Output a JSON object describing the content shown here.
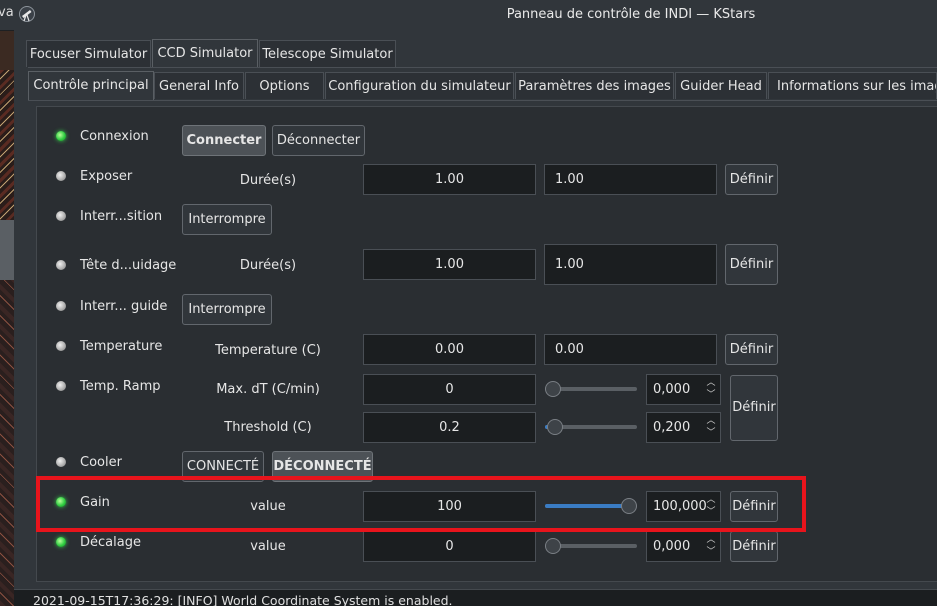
{
  "window": {
    "title": "Panneau de contrôle de INDI — KStars",
    "left_edge_text": "va"
  },
  "device_tabs": [
    {
      "label": "Focuser Simulator",
      "active": false
    },
    {
      "label": "CCD Simulator",
      "active": true
    },
    {
      "label": "Telescope Simulator",
      "active": false
    }
  ],
  "group_tabs": [
    {
      "label": "Contrôle principal",
      "active": true
    },
    {
      "label": "General Info",
      "active": false
    },
    {
      "label": "Options",
      "active": false
    },
    {
      "label": "Configuration du simulateur",
      "active": false
    },
    {
      "label": "Paramètres des images",
      "active": false
    },
    {
      "label": "Guider Head",
      "active": false
    },
    {
      "label": "Informations sur les images",
      "active": false
    }
  ],
  "properties": {
    "connexion": {
      "label": "Connexion",
      "state": "green",
      "btn_connect": "Connecter",
      "btn_disconnect": "Déconnecter"
    },
    "exposer": {
      "label": "Exposer",
      "state": "grey",
      "elem_label": "Durée(s)",
      "value": "1.00",
      "input": "1.00",
      "set": "Définir"
    },
    "abort": {
      "label": "Interr...sition",
      "state": "grey",
      "btn": "Interrompre"
    },
    "guide_head": {
      "label": "Tête d...uidage",
      "state": "grey",
      "elem_label": "Durée(s)",
      "value": "1.00",
      "input": "1.00",
      "set": "Définir"
    },
    "abort_guide": {
      "label": "Interr... guide",
      "state": "grey",
      "btn": "Interrompre"
    },
    "temperature": {
      "label": "Temperature",
      "state": "grey",
      "elem_label": "Temperature (C)",
      "value": "0.00",
      "input": "0.00",
      "set": "Définir"
    },
    "temp_ramp": {
      "label": "Temp. Ramp",
      "state": "grey",
      "set": "Définir",
      "max_dt": {
        "label": "Max. dT (C/min)",
        "value": "0",
        "spin": "0,000",
        "level": 0
      },
      "threshold": {
        "label": "Threshold (C)",
        "value": "0.2",
        "spin": "0,200",
        "level": 0.02
      }
    },
    "cooler": {
      "label": "Cooler",
      "state": "grey",
      "btn_on": "CONNECTÉ",
      "btn_off": "DÉCONNECTÉ"
    },
    "gain": {
      "label": "Gain",
      "state": "green",
      "elem_label": "value",
      "value": "100",
      "spin": "100,000",
      "level": 1.0,
      "set": "Définir"
    },
    "offset": {
      "label": "Décalage",
      "state": "green",
      "elem_label": "value",
      "value": "0",
      "spin": "0,000",
      "level": 0,
      "set": "Définir"
    }
  },
  "status_log": "2021-09-15T17:36:29: [INFO] World Coordinate System is enabled.",
  "colors": {
    "highlight": "#e8141c",
    "led_green": "#2ecc40",
    "slider_fill": "#3a7cc4"
  }
}
